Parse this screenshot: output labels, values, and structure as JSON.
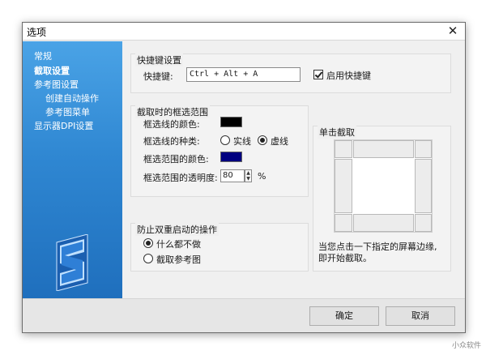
{
  "window": {
    "title": "选项",
    "close_glyph": "✕"
  },
  "sidebar": {
    "items": [
      {
        "label": "常规"
      },
      {
        "label": "截取设置"
      },
      {
        "label": "参考图设置"
      },
      {
        "label": "创建自动操作"
      },
      {
        "label": "参考图菜单"
      },
      {
        "label": "显示器DPI设置"
      }
    ],
    "active_index": 1,
    "logo_icon": "app-logo-icon"
  },
  "hotkey_group": {
    "title": "快捷键设置",
    "label": "快捷键:",
    "value": "Ctrl + Alt + A",
    "enable_label": "启用快捷键",
    "enabled": true
  },
  "frame_group": {
    "title": "截取时的框选范围",
    "line_color_label": "框选线的颜色:",
    "line_color": "#000000",
    "line_type_label": "框选线的种类:",
    "line_type_options": [
      "实线",
      "虚线"
    ],
    "line_type_selected": "虚线",
    "range_color_label": "框选范围的颜色:",
    "range_color": "#000080",
    "opacity_label": "框选范围的透明度:",
    "opacity_value": "80",
    "opacity_unit": "%"
  },
  "click_group": {
    "title": "单击截取",
    "description_line1": "当您点击一下指定的屏幕边缘,",
    "description_line2": "即开始截取。"
  },
  "dup_group": {
    "title": "防止双重启动的操作",
    "options": [
      "什么都不做",
      "截取参考图"
    ],
    "selected": "什么都不做"
  },
  "footer": {
    "ok_label": "确定",
    "cancel_label": "取消"
  },
  "watermark": "小众软件"
}
